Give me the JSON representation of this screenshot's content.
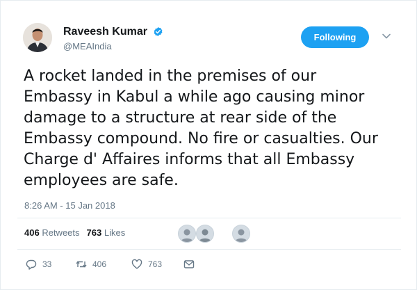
{
  "author": {
    "name": "Raveesh Kumar",
    "handle": "@MEAIndia"
  },
  "follow_button": {
    "label": "Following"
  },
  "tweet": {
    "text_lines": [
      "A rocket landed in the premises of our",
      "Embassy in Kabul a while ago causing minor",
      "damage to a structure at rear side of the",
      "Embassy compound. No fire or casualties. Our",
      "Charge d' Affaires informs that all Embassy",
      "employees are safe."
    ],
    "timestamp": "8:26 AM - 15 Jan 2018"
  },
  "stats": {
    "retweets_count": "406",
    "retweets_label": "Retweets",
    "likes_count": "763",
    "likes_label": "Likes"
  },
  "actions": {
    "reply_count": "33",
    "retweet_count": "406",
    "like_count": "763"
  },
  "colors": {
    "accent": "#1da1f2",
    "text_primary": "#14171a",
    "text_secondary": "#657786",
    "divider": "#e6ecf0"
  },
  "icons": [
    "verified-badge-icon",
    "chevron-down-icon",
    "reply-icon",
    "retweet-icon",
    "like-icon",
    "direct-message-icon"
  ]
}
